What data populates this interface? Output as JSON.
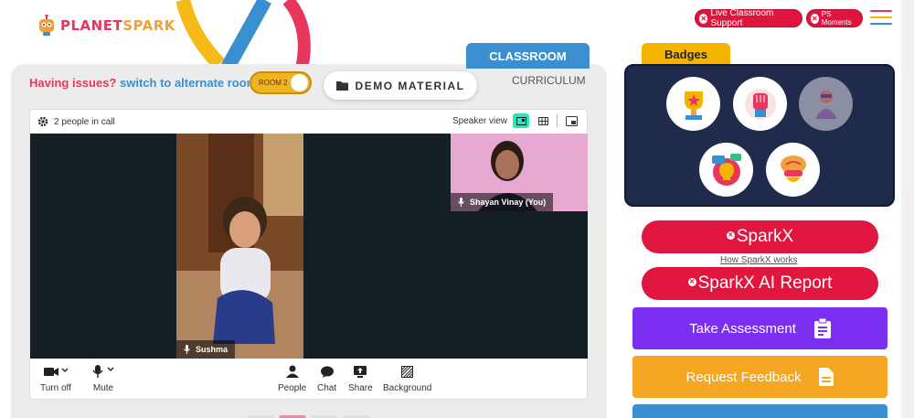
{
  "header": {
    "logo": "PLANETSPARK",
    "live_support": "Live Classroom Support",
    "ps_moments": "PS Moments"
  },
  "tabs": {
    "classroom": "CLASSROOM",
    "curriculum": "CURRICULUM"
  },
  "room": {
    "issues_text": "Having issues?",
    "switch_text": "switch to alternate room",
    "toggle_label": "ROOM 2",
    "demo_material": "DEMO MATERIAL"
  },
  "call": {
    "people_count": "2 people in call",
    "speaker_view": "Speaker view",
    "main_participant": "Sushma",
    "self_participant": "Shayan Vinay (You)",
    "controls": {
      "turn_off": "Turn off",
      "mute": "Mute",
      "people": "People",
      "chat": "Chat",
      "share": "Share",
      "background": "Background"
    }
  },
  "badges": {
    "title": "Badges",
    "items": [
      "trophy-badge",
      "fist-badge",
      "superhero-badge",
      "idea-badge",
      "brain-badge"
    ]
  },
  "sparkx": {
    "label": "SparkX",
    "how_link": "How SparkX works",
    "report_label": "SparkX AI Report"
  },
  "actions": {
    "assessment": "Take Assessment",
    "feedback": "Request Feedback"
  },
  "colors": {
    "brand_red": "#e0163f",
    "classroom_blue": "#3a8fd0",
    "badges_panel": "#1f2a4d",
    "badges_yellow": "#f5b400",
    "assessment_purple": "#7b2ff2",
    "feedback_orange": "#f5a623"
  }
}
